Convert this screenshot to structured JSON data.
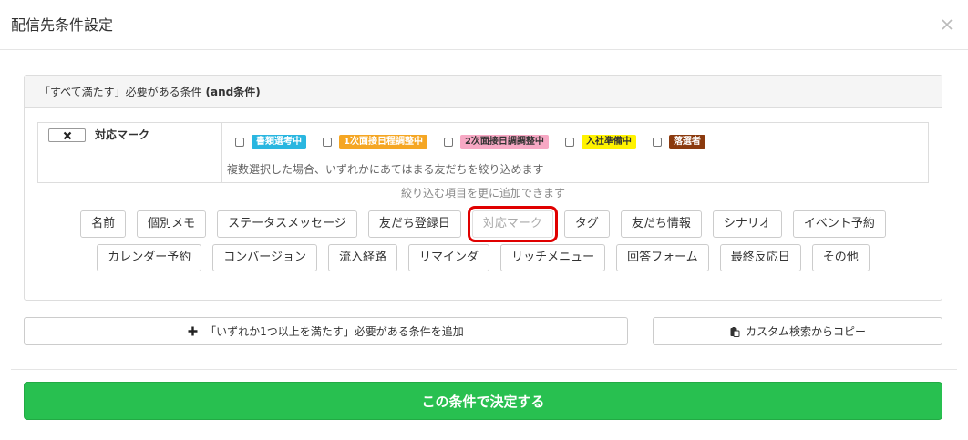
{
  "modal": {
    "title": "配信先条件設定"
  },
  "panel": {
    "header_prefix": "「すべて満たす」必要がある条件 ",
    "header_bold": "(and条件)"
  },
  "condition": {
    "label": "対応マーク",
    "options": [
      {
        "label": "書類選考中",
        "bg": "#29b6e0",
        "fg": "#ffffff"
      },
      {
        "label": "1次面接日程調整中",
        "bg": "#f5a623",
        "fg": "#ffffff"
      },
      {
        "label": "2次面接日調調整中",
        "bg": "#f7a8c4",
        "fg": "#333333"
      },
      {
        "label": "入社準備中",
        "bg": "#fff200",
        "fg": "#333333"
      },
      {
        "label": "落選者",
        "bg": "#8b3a0e",
        "fg": "#ffffff"
      }
    ],
    "hint": "複数選択した場合、いずれかにあてはまる友だちを絞り込めます"
  },
  "add_hint": "絞り込む項目を更に追加できます",
  "filters_row1": [
    "名前",
    "個別メモ",
    "ステータスメッセージ",
    "友だち登録日",
    "対応マーク",
    "タグ",
    "友だち情報",
    "シナリオ",
    "イベント予約"
  ],
  "filters_row2": [
    "カレンダー予約",
    "コンバージョン",
    "流入経路",
    "リマインダ",
    "リッチメニュー",
    "回答フォーム",
    "最終反応日",
    "その他"
  ],
  "active_filter": "対応マーク",
  "add_or_label": "「いずれか1つ以上を満たす」必要がある条件を追加",
  "copy_label": "カスタム検索からコピー",
  "submit_label": "この条件で決定する",
  "colors": {
    "submit": "#28c050",
    "highlight": "#e00000"
  }
}
